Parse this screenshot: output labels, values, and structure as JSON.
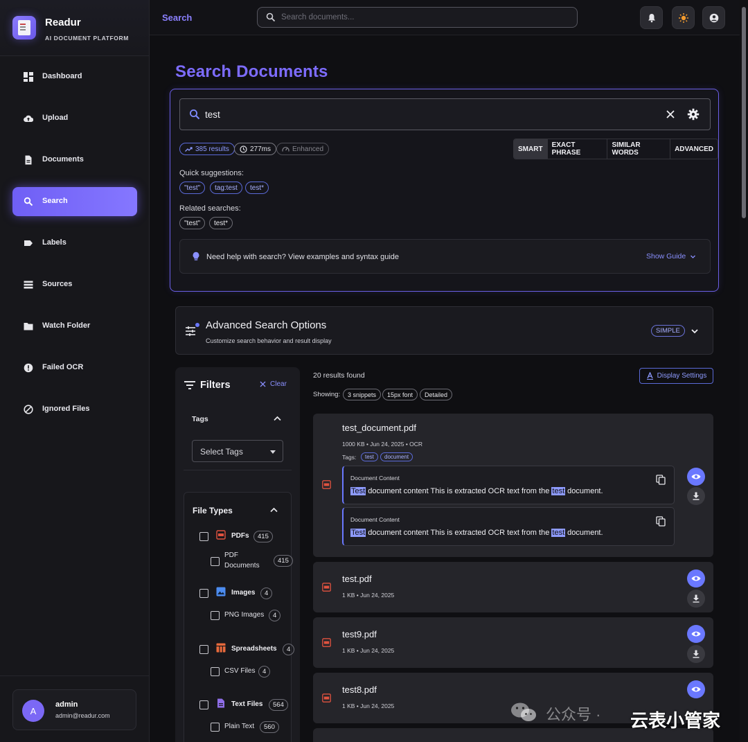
{
  "brand": {
    "name": "Readur",
    "tagline": "AI DOCUMENT PLATFORM"
  },
  "sidebar": {
    "items": [
      {
        "label": "Dashboard",
        "icon": "dashboard-icon",
        "active": false
      },
      {
        "label": "Upload",
        "icon": "cloud-upload-icon",
        "active": false
      },
      {
        "label": "Documents",
        "icon": "document-icon",
        "active": false
      },
      {
        "label": "Search",
        "icon": "search-icon",
        "active": true
      },
      {
        "label": "Labels",
        "icon": "label-icon",
        "active": false
      },
      {
        "label": "Sources",
        "icon": "sources-icon",
        "active": false
      },
      {
        "label": "Watch Folder",
        "icon": "folder-icon",
        "active": false
      },
      {
        "label": "Failed OCR",
        "icon": "error-icon",
        "active": false
      },
      {
        "label": "Ignored Files",
        "icon": "block-icon",
        "active": false
      }
    ]
  },
  "user": {
    "initial": "A",
    "name": "admin",
    "email": "admin@readur.com"
  },
  "topbar": {
    "title": "Search",
    "search_placeholder": "Search documents..."
  },
  "page": {
    "title": "Search Documents"
  },
  "search": {
    "query": "test",
    "stats": {
      "results": "385 results",
      "time": "277ms",
      "mode": "Enhanced"
    },
    "modes": [
      "SMART",
      "EXACT PHRASE",
      "SIMILAR WORDS",
      "ADVANCED"
    ],
    "active_mode": "SMART",
    "quick_label": "Quick suggestions:",
    "quick": [
      "\"test\"",
      "tag:test",
      "test*"
    ],
    "related_label": "Related searches:",
    "related": [
      "\"test\"",
      "test*"
    ],
    "help_text": "Need help with search? View examples and syntax guide",
    "help_link": "Show Guide"
  },
  "advanced": {
    "title": "Advanced Search Options",
    "subtitle": "Customize search behavior and result display",
    "mode": "SIMPLE"
  },
  "filters": {
    "title": "Filters",
    "clear": "Clear",
    "tags_label": "Tags",
    "tags_placeholder": "Select Tags",
    "file_types_label": "File Types",
    "groups": [
      {
        "name": "PDFs",
        "count": "415",
        "icon": "pdf-icon",
        "sub": "PDF Documents",
        "sub_count": "415"
      },
      {
        "name": "Images",
        "count": "4",
        "icon": "image-icon",
        "sub": "PNG Images",
        "sub_count": "4"
      },
      {
        "name": "Spreadsheets",
        "count": "4",
        "icon": "spreadsheet-icon",
        "sub": "CSV Files",
        "sub_count": "4"
      },
      {
        "name": "Text Files",
        "count": "564",
        "icon": "text-file-icon",
        "sub": "Plain Text",
        "sub_count": "560"
      }
    ]
  },
  "results": {
    "count_label": "20 results found",
    "display_settings": "Display Settings",
    "showing_label": "Showing:",
    "showing": [
      "3 snippets",
      "15px font",
      "Detailed"
    ],
    "items": [
      {
        "name": "test_document.pdf",
        "meta": "1000 KB • Jun 24, 2025 • OCR",
        "tags_label": "Tags:",
        "tags": [
          "test",
          "document"
        ],
        "snippets": [
          {
            "title": "Document Content",
            "pre": "",
            "hl1": "Test",
            "mid": " document content This is extracted OCR text from the ",
            "hl2": "test",
            "post": " document."
          },
          {
            "title": "Document Content",
            "pre": "",
            "hl1": "Test",
            "mid": " document content This is extracted OCR text from the ",
            "hl2": "test",
            "post": " document."
          }
        ]
      },
      {
        "name": "test.pdf",
        "meta": "1 KB • Jun 24, 2025"
      },
      {
        "name": "test9.pdf",
        "meta": "1 KB • Jun 24, 2025"
      },
      {
        "name": "test8.pdf",
        "meta": "1 KB • Jun 24, 2025"
      }
    ]
  },
  "watermark": {
    "text1": "公众号 · ",
    "text2": "云表小管家"
  },
  "colors": {
    "accent": "#7d6cff",
    "link": "#8a90ff",
    "view_button": "#6a78ff",
    "pdf": "#e0523f"
  }
}
